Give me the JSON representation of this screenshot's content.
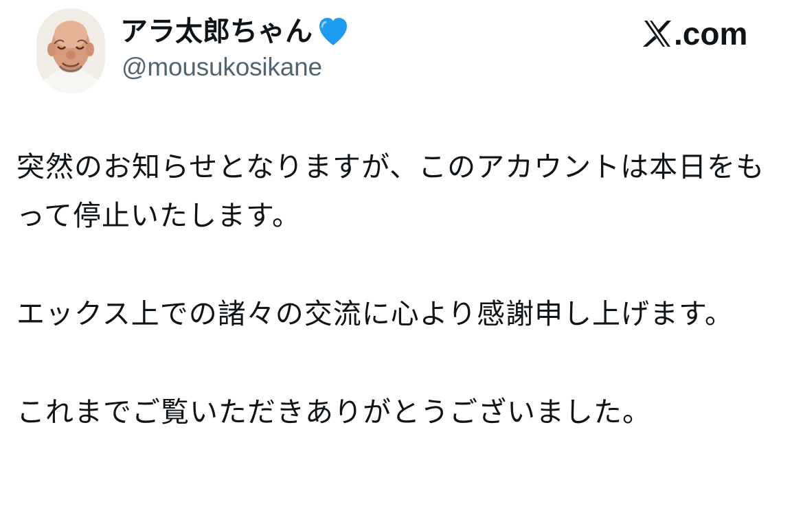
{
  "post": {
    "display_name": "アラ太郎ちゃん",
    "handle": "@mousukosikane",
    "brand": ".com",
    "badge_icon": "blue-heart-icon",
    "brand_icon": "x-logo-icon",
    "paragraphs": [
      "突然のお知らせとなりますが、このアカウントは本日をもって停止いたします。",
      "エックス上での諸々の交流に心より感謝申し上げます。",
      "これまでご覧いただきありがとうございました。"
    ]
  },
  "colors": {
    "text": "#0f1419",
    "handle": "#536471",
    "heart": "#1d9bf0"
  }
}
